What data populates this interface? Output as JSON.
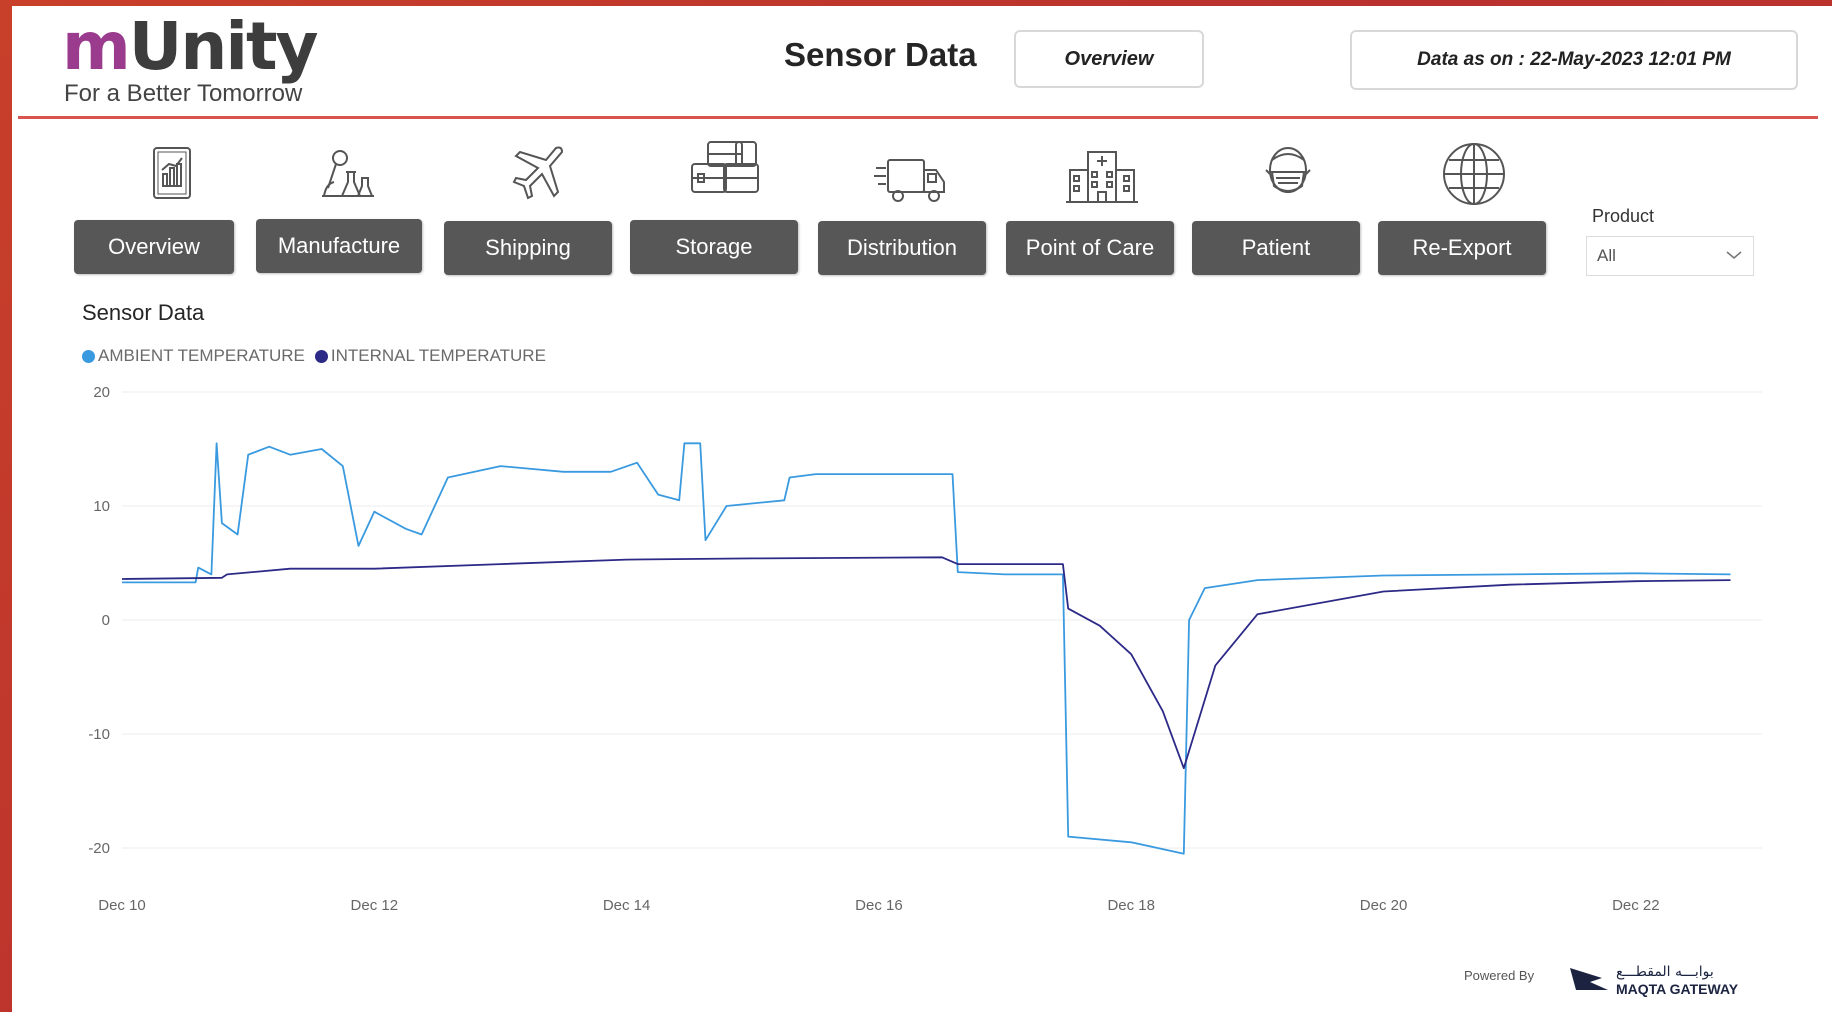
{
  "brand": {
    "logo_main": "Unity",
    "logo_m": "m",
    "tagline": "For a Better Tomorrow"
  },
  "header": {
    "title": "Sensor Data",
    "view_label": "Overview",
    "data_as_on": "Data as on : 22-May-2023 12:01 PM"
  },
  "nav": [
    {
      "label": "Overview",
      "icon": "report-chart-icon"
    },
    {
      "label": "Manufacture",
      "icon": "lab-microscope-icon"
    },
    {
      "label": "Shipping",
      "icon": "airplane-icon"
    },
    {
      "label": "Storage",
      "icon": "storage-boxes-icon"
    },
    {
      "label": "Distribution",
      "icon": "delivery-truck-icon"
    },
    {
      "label": "Point of Care",
      "icon": "hospital-icon"
    },
    {
      "label": "Patient",
      "icon": "patient-mask-icon"
    },
    {
      "label": "Re-Export",
      "icon": "globe-icon"
    }
  ],
  "filter": {
    "label": "Product",
    "selected": "All"
  },
  "footer": {
    "powered_by": "Powered By",
    "partner_arabic": "بوابـــه المقطـــع",
    "partner_name": "MAQTA GATEWAY"
  },
  "colors": {
    "ambient": "#3a9ae0",
    "internal": "#2d2a87",
    "nav_button": "#575757",
    "header_rule": "#d9534f",
    "brand_m": "#9a3b8e"
  },
  "chart_data": {
    "type": "line",
    "title": "Sensor Data",
    "xlabel": "",
    "ylabel": "",
    "ylim": [
      -20,
      20
    ],
    "yticks": [
      20,
      10,
      0,
      -10,
      -20
    ],
    "xlim": [
      "2022-12-10",
      "2022-12-23"
    ],
    "xticks": [
      "Dec 10",
      "Dec 12",
      "Dec 14",
      "Dec 16",
      "Dec 18",
      "Dec 20",
      "Dec 22"
    ],
    "grid": true,
    "legend_position": "top-left",
    "series": [
      {
        "name": "AMBIENT TEMPERATURE",
        "points": [
          [
            "2022-12-10 00:00",
            3.3
          ],
          [
            "2022-12-10 14:00",
            3.3
          ],
          [
            "2022-12-10 14:30",
            4.6
          ],
          [
            "2022-12-10 17:00",
            4.0
          ],
          [
            "2022-12-10 18:00",
            15.5
          ],
          [
            "2022-12-10 19:00",
            8.5
          ],
          [
            "2022-12-10 22:00",
            7.5
          ],
          [
            "2022-12-11 00:00",
            14.5
          ],
          [
            "2022-12-11 04:00",
            15.2
          ],
          [
            "2022-12-11 08:00",
            14.5
          ],
          [
            "2022-12-11 14:00",
            15.0
          ],
          [
            "2022-12-11 18:00",
            13.5
          ],
          [
            "2022-12-11 21:00",
            6.5
          ],
          [
            "2022-12-12 00:00",
            9.5
          ],
          [
            "2022-12-12 06:00",
            8.0
          ],
          [
            "2022-12-12 09:00",
            7.5
          ],
          [
            "2022-12-12 14:00",
            12.5
          ],
          [
            "2022-12-13 00:00",
            13.5
          ],
          [
            "2022-12-13 12:00",
            13.0
          ],
          [
            "2022-12-13 21:00",
            13.0
          ],
          [
            "2022-12-14 02:00",
            13.8
          ],
          [
            "2022-12-14 06:00",
            11.0
          ],
          [
            "2022-12-14 10:00",
            10.5
          ],
          [
            "2022-12-14 11:00",
            15.5
          ],
          [
            "2022-12-14 14:00",
            15.5
          ],
          [
            "2022-12-14 15:00",
            7.0
          ],
          [
            "2022-12-14 19:00",
            10.0
          ],
          [
            "2022-12-15 06:00",
            10.5
          ],
          [
            "2022-12-15 07:00",
            12.5
          ],
          [
            "2022-12-15 12:00",
            12.8
          ],
          [
            "2022-12-16 14:00",
            12.8
          ],
          [
            "2022-12-16 15:00",
            4.2
          ],
          [
            "2022-12-17 00:00",
            4.0
          ],
          [
            "2022-12-17 11:00",
            4.0
          ],
          [
            "2022-12-17 12:00",
            -19.0
          ],
          [
            "2022-12-18 00:00",
            -19.5
          ],
          [
            "2022-12-18 10:00",
            -20.5
          ],
          [
            "2022-12-18 11:00",
            0.0
          ],
          [
            "2022-12-18 14:00",
            2.8
          ],
          [
            "2022-12-19 00:00",
            3.5
          ],
          [
            "2022-12-20 00:00",
            3.9
          ],
          [
            "2022-12-21 00:00",
            4.0
          ],
          [
            "2022-12-22 00:00",
            4.1
          ],
          [
            "2022-12-22 18:00",
            4.0
          ]
        ]
      },
      {
        "name": "INTERNAL TEMPERATURE",
        "points": [
          [
            "2022-12-10 00:00",
            3.6
          ],
          [
            "2022-12-10 19:00",
            3.7
          ],
          [
            "2022-12-10 20:00",
            4.0
          ],
          [
            "2022-12-11 08:00",
            4.5
          ],
          [
            "2022-12-12 00:00",
            4.5
          ],
          [
            "2022-12-13 00:00",
            4.9
          ],
          [
            "2022-12-14 00:00",
            5.3
          ],
          [
            "2022-12-15 00:00",
            5.4
          ],
          [
            "2022-12-16 12:00",
            5.5
          ],
          [
            "2022-12-16 15:00",
            4.9
          ],
          [
            "2022-12-17 11:00",
            4.9
          ],
          [
            "2022-12-17 12:00",
            1.0
          ],
          [
            "2022-12-17 18:00",
            -0.5
          ],
          [
            "2022-12-18 00:00",
            -3.0
          ],
          [
            "2022-12-18 06:00",
            -8.0
          ],
          [
            "2022-12-18 10:00",
            -13.0
          ],
          [
            "2022-12-18 16:00",
            -4.0
          ],
          [
            "2022-12-19 00:00",
            0.5
          ],
          [
            "2022-12-20 00:00",
            2.5
          ],
          [
            "2022-12-21 00:00",
            3.1
          ],
          [
            "2022-12-22 00:00",
            3.4
          ],
          [
            "2022-12-22 18:00",
            3.5
          ]
        ]
      }
    ]
  }
}
